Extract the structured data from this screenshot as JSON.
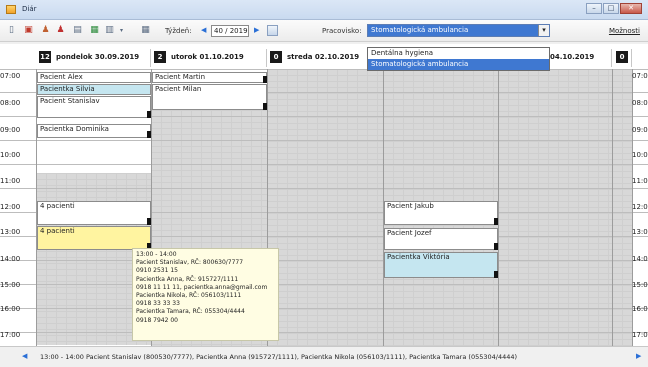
{
  "window": {
    "title": "Diár",
    "minimize_label": "–",
    "maximize_label": "□",
    "close_label": "✕"
  },
  "toolbar": {
    "week_label": "Týždeň:",
    "week_value": "40 / 2019",
    "workplace_label": "Pracovisko:",
    "workplace_value": "Stomatologická ambulancia",
    "options_label": "Možnosti"
  },
  "workplace_dropdown": {
    "options": [
      "Dentálna hygiena",
      "Stomatologická ambulancia"
    ],
    "selected_index": 1
  },
  "days": [
    {
      "num": "12",
      "label": "pondelok 30.09.2019"
    },
    {
      "num": "2",
      "label": "utorok 01.10.2019"
    },
    {
      "num": "0",
      "label": "streda 02.10.2019"
    },
    {
      "num": "",
      "label": ""
    },
    {
      "num": "",
      "label": "04.10.2019"
    },
    {
      "num": "0",
      "label": ""
    }
  ],
  "hours": [
    "07:00",
    "08:00",
    "09:00",
    "10:00",
    "11:00",
    "12:00",
    "13:00",
    "14:00",
    "15:00",
    "16:00",
    "17:00"
  ],
  "hours_right": [
    "07:0",
    "08:0",
    "09:0",
    "10:0",
    "11:0",
    "12:0",
    "13:0",
    "14:0",
    "15:0",
    "16:0",
    "17:0"
  ],
  "appointments": {
    "mon_1": "Pacient Alex",
    "mon_2": "Pacientka Silvia",
    "mon_3": "Pacient Stanislav",
    "mon_4": "Pacientka Dominika",
    "mon_5": "4 pacienti",
    "mon_6": "4 pacienti",
    "tue_1": "Pacient Martin",
    "tue_2": "Pacient Milan",
    "thu_1": "Pacient Jakub",
    "thu_2": "Pacient Jozef",
    "thu_3": "Pacientka Viktória"
  },
  "tooltip": {
    "lines": [
      "13:00 - 14:00",
      "Pacient Stanislav, RČ: 800630/7777",
      "0910 2531 15",
      "Pacientka Anna, RČ: 915727/1111",
      "0918 11 11 11, pacientka.anna@gmail.com",
      "Pacientka Nikola, RČ: 056103/1111",
      "0918 33 33 33",
      "Pacientka Tamara, RČ: 055304/4444",
      "0918 7942 00"
    ]
  },
  "statusbar": {
    "text": "13:00 - 14:00   Pacient Stanislav (800530/7777), Pacientka Anna (915727/1111), Pacientka Nikola (056103/1111), Pacientka Tamara (055304/4444)"
  }
}
